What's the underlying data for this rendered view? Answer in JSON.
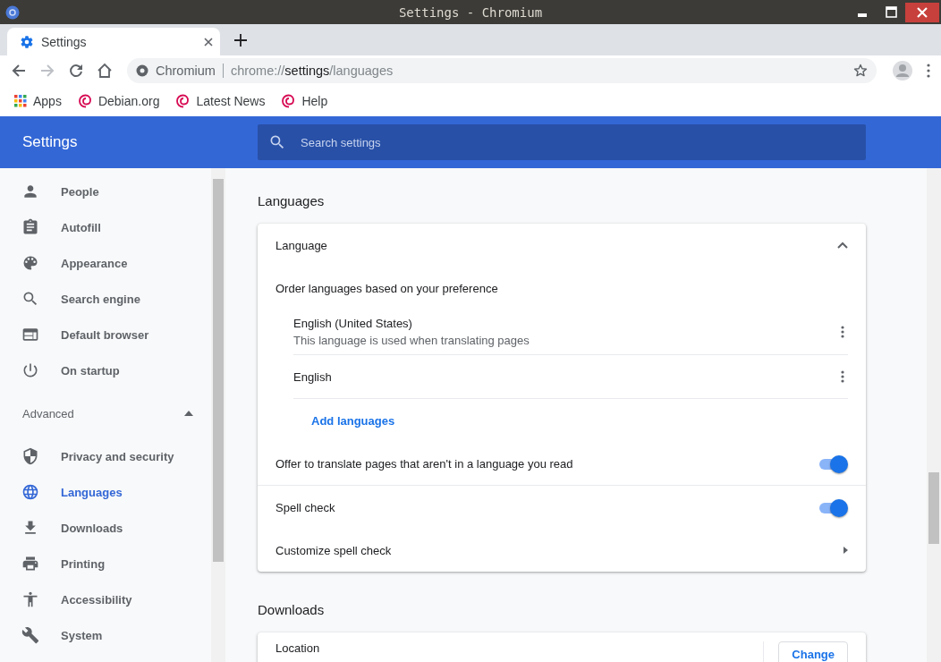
{
  "window": {
    "title": "Settings - Chromium"
  },
  "tabs": [
    {
      "label": "Settings",
      "selected": true
    }
  ],
  "address": {
    "site": "Chromium",
    "scheme": "chrome://",
    "host": "settings",
    "path": "/languages"
  },
  "bookmarks": [
    {
      "label": "Apps",
      "kind": "apps"
    },
    {
      "label": "Debian.org",
      "kind": "site"
    },
    {
      "label": "Latest News",
      "kind": "site"
    },
    {
      "label": "Help",
      "kind": "site"
    }
  ],
  "header": {
    "title": "Settings",
    "search": {
      "placeholder": "Search settings"
    }
  },
  "sidebar": {
    "items": [
      {
        "label": "People",
        "selected": false
      },
      {
        "label": "Autofill",
        "selected": false
      },
      {
        "label": "Appearance",
        "selected": false
      },
      {
        "label": "Search engine",
        "selected": false
      },
      {
        "label": "Default browser",
        "selected": false
      },
      {
        "label": "On startup",
        "selected": false
      }
    ],
    "advanced": {
      "label": "Advanced",
      "expanded": true
    },
    "advanced_items": [
      {
        "label": "Privacy and security",
        "selected": false
      },
      {
        "label": "Languages",
        "selected": true
      },
      {
        "label": "Downloads",
        "selected": false
      },
      {
        "label": "Printing",
        "selected": false
      },
      {
        "label": "Accessibility",
        "selected": false
      },
      {
        "label": "System",
        "selected": false
      }
    ]
  },
  "main": {
    "section_title": "Languages",
    "card": {
      "title": "Language",
      "expanded": true,
      "subtitle": "Order languages based on your preference",
      "languages": [
        {
          "name": "English (United States)",
          "note": "This language is used when translating pages"
        },
        {
          "name": "English"
        }
      ],
      "add_link": "Add languages",
      "toggles": [
        {
          "label": "Offer to translate pages that aren't in a language you read",
          "on": true
        },
        {
          "label": "Spell check",
          "on": true
        }
      ],
      "link_row": "Customize spell check"
    },
    "downloads_title": "Downloads",
    "downloads_card": {
      "label": "Location",
      "button": "Change"
    }
  }
}
